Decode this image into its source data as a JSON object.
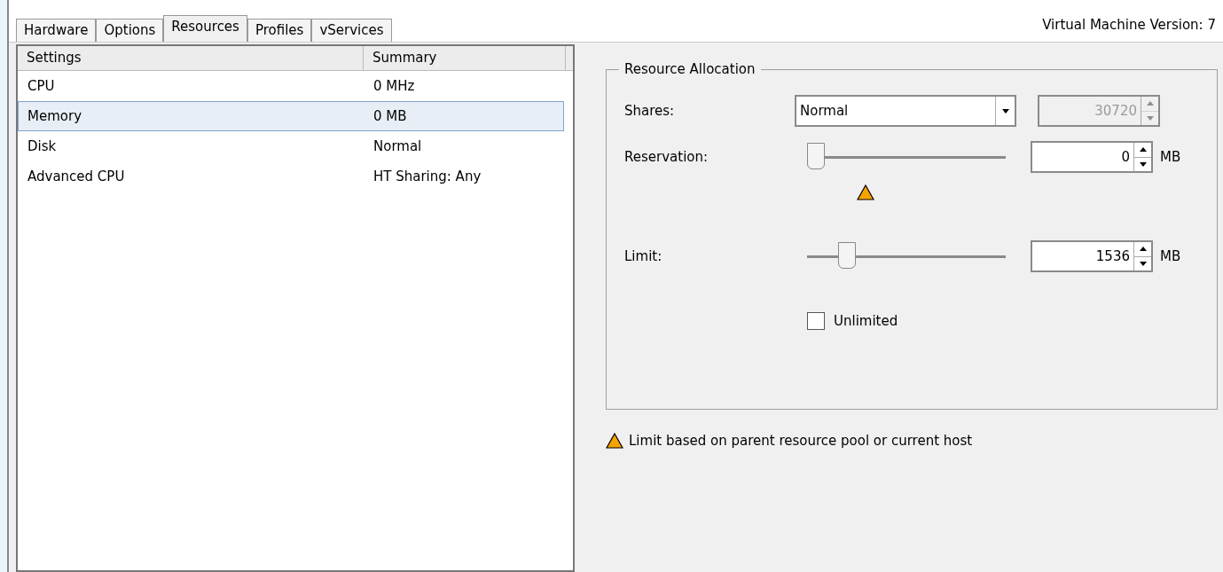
{
  "tabs": [
    {
      "label": "Hardware",
      "selected": false
    },
    {
      "label": "Options",
      "selected": false
    },
    {
      "label": "Resources",
      "selected": true
    },
    {
      "label": "Profiles",
      "selected": false
    },
    {
      "label": "vServices",
      "selected": false
    }
  ],
  "version_label": "Virtual Machine Version: 7",
  "settings_table": {
    "columns": [
      "Settings",
      "Summary"
    ],
    "rows": [
      {
        "setting": "CPU",
        "summary": "0 MHz",
        "selected": false
      },
      {
        "setting": "Memory",
        "summary": "0 MB",
        "selected": true
      },
      {
        "setting": "Disk",
        "summary": "Normal",
        "selected": false
      },
      {
        "setting": "Advanced CPU",
        "summary": "HT Sharing: Any",
        "selected": false
      }
    ]
  },
  "resource_allocation": {
    "title": "Resource Allocation",
    "shares": {
      "label": "Shares:",
      "value": "Normal",
      "number": "30720",
      "number_disabled": true
    },
    "reservation": {
      "label": "Reservation:",
      "level": 0,
      "value": "0",
      "unit": "MB",
      "warning": true
    },
    "limit": {
      "label": "Limit:",
      "level": 0.17,
      "value": "1536",
      "unit": "MB",
      "warning": false
    },
    "unlimited": {
      "label": "Unlimited",
      "checked": false
    }
  },
  "note": "Limit based on parent resource pool or current host"
}
